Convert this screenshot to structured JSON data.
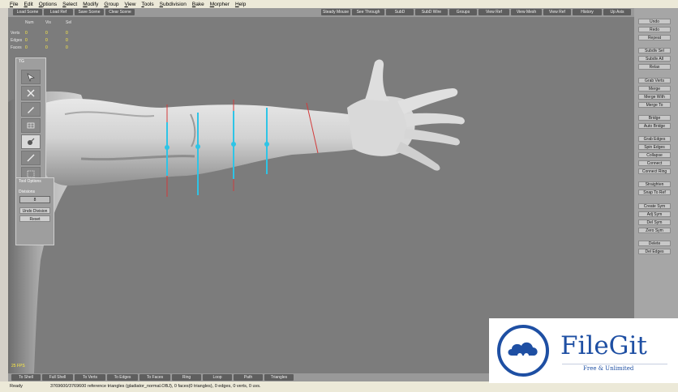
{
  "menu": [
    "File",
    "Edit",
    "Options",
    "Select",
    "Modify",
    "Group",
    "View",
    "Tools",
    "Subdivision",
    "Bake",
    "Morpher",
    "Help"
  ],
  "toolbar": {
    "left": [
      "Load Scene",
      "Load Ref",
      "Save Scene",
      "Clear Scene"
    ],
    "right": [
      "Steady Mouse",
      "See Through",
      "SubD",
      "SubD Wire",
      "Groups",
      "View Ref",
      "View Mesh",
      "View Ref",
      "History",
      "Up Axis"
    ]
  },
  "stats": {
    "headers": [
      "Num",
      "Vis",
      "Sel"
    ],
    "rows": [
      {
        "label": "Verts",
        "values": [
          "0",
          "0",
          "0"
        ]
      },
      {
        "label": "Edges",
        "values": [
          "0",
          "0",
          "0"
        ]
      },
      {
        "label": "Faces",
        "values": [
          "0",
          "0",
          "0"
        ]
      }
    ]
  },
  "tg_panel": {
    "title": "TG"
  },
  "tool_options": {
    "title": "Tool Options",
    "divisions_label": "Divisions",
    "divisions_value": "8",
    "undo_label": "Undo Division",
    "reset_label": "Reset"
  },
  "fps": "25 FPS",
  "right_buttons": [
    "Undo",
    "Redo",
    "Repeat",
    "Subdiv Sel",
    "Subdiv All",
    "Relax",
    "Grab Verts",
    "Merge",
    "Merge With",
    "Merge To",
    "Bridge",
    "Auto Bridge",
    "Grab Edges",
    "Spin Edges",
    "Collapse",
    "Connect",
    "Connect Ring",
    "Straighten",
    "Snap To Ref",
    "Create Sym",
    "Adj Sym",
    "Del Sym",
    "Zero Sym",
    "Delete",
    "Del Edges"
  ],
  "bottom_buttons": [
    "To Shell",
    "Full Shell",
    "To Verts",
    "To Edges",
    "To Faces",
    "Ring",
    "Loop",
    "Path",
    "Triangles"
  ],
  "status": {
    "ready": "Ready",
    "info": "3769600/3769600 reference triangles (gladiator_normal.OBJ), 0 faces(0 triangles), 0 edges, 0 verts, 0 uvs."
  },
  "watermark": {
    "title": "FileGit",
    "subtitle": "Free & Unlimited"
  },
  "colors": {
    "accent_blue": "#1e4fa3",
    "guide_cyan": "#2ec4e6",
    "guide_red": "#d23a3a",
    "stats_yellow": "#ffee44"
  }
}
